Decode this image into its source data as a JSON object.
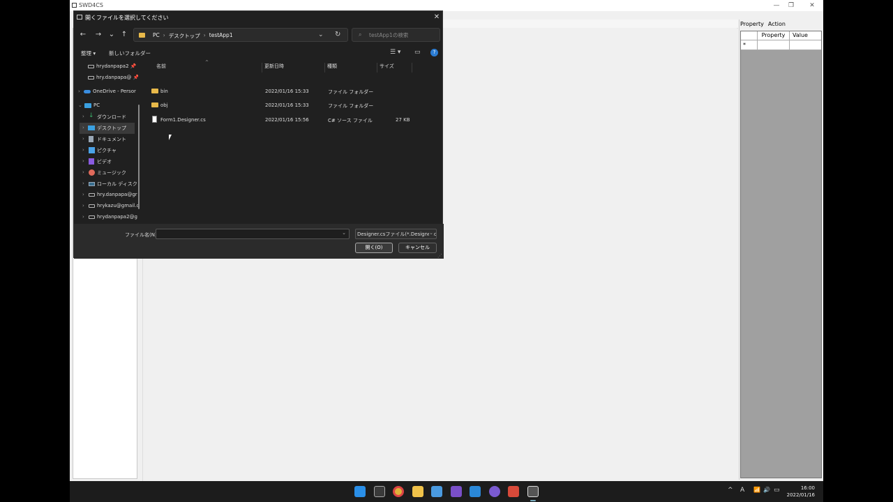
{
  "app": {
    "title": "SWD4CS",
    "window_controls": {
      "minimize": "—",
      "restore": "❐",
      "close": "✕"
    },
    "property_panel": {
      "tabs": [
        "Property",
        "Action"
      ],
      "columns": [
        "Property",
        "Value"
      ],
      "new_row_marker": "*"
    }
  },
  "dialog": {
    "title": "開くファイルを選択してください",
    "close": "✕",
    "nav": {
      "back": "←",
      "forward": "→",
      "recent": "⌄",
      "up": "↑",
      "dropdown": "⌄",
      "refresh": "↻"
    },
    "breadcrumb": [
      "PC",
      "デスクトップ",
      "testApp1"
    ],
    "breadcrumb_sep": "›",
    "search_placeholder": "testApp1の検索",
    "commands": {
      "organize": "整理 ▾",
      "new_folder": "新しいフォルダー",
      "view": "☰ ▾",
      "preview": "▭",
      "help": "?"
    },
    "nav_pane": [
      {
        "label": "hrydanpapa2 📌",
        "icon": "drive-icon"
      },
      {
        "label": "hry.danpapa@ 📌",
        "icon": "drive-icon"
      },
      {
        "label": "OneDrive - Persor",
        "icon": "onedrive-icon"
      },
      {
        "label": "PC",
        "icon": "pc-icon"
      },
      {
        "label": "ダウンロード",
        "icon": "download-icon"
      },
      {
        "label": "デスクトップ",
        "icon": "desktop-icon"
      },
      {
        "label": "ドキュメント",
        "icon": "document-icon"
      },
      {
        "label": "ピクチャ",
        "icon": "picture-icon"
      },
      {
        "label": "ビデオ",
        "icon": "video-icon"
      },
      {
        "label": "ミュージック",
        "icon": "music-icon"
      },
      {
        "label": "ローカル ディスク (C",
        "icon": "disk-icon"
      },
      {
        "label": "hry.danpapa@gr",
        "icon": "drive-icon"
      },
      {
        "label": "hrykazu@gmail.c",
        "icon": "drive-icon"
      },
      {
        "label": "hrydanpapa2@g",
        "icon": "drive-icon"
      }
    ],
    "columns": {
      "name": "名前",
      "modified": "更新日時",
      "type": "種類",
      "size": "サイズ"
    },
    "files": [
      {
        "name": "bin",
        "modified": "2022/01/16 15:33",
        "type": "ファイル フォルダー",
        "size": "",
        "icon": "folder-icon"
      },
      {
        "name": "obj",
        "modified": "2022/01/16 15:33",
        "type": "ファイル フォルダー",
        "size": "",
        "icon": "folder-icon"
      },
      {
        "name": "Form1.Designer.cs",
        "modified": "2022/01/16 15:56",
        "type": "C# ソース ファイル",
        "size": "27 KB",
        "icon": "csharp-file-icon"
      }
    ],
    "filename_label": "ファイル名(N):",
    "filename_value": "",
    "filetype_value": "Designer.csファイル(*.Designer.cs)",
    "open_button": "開く(O)",
    "cancel_button": "キャンセル"
  },
  "taskbar": {
    "icons": [
      "windows-start-icon",
      "task-view-icon",
      "chrome-icon",
      "file-explorer-icon",
      "store-icon",
      "visual-studio-icon",
      "vscode-icon",
      "github-icon",
      "office-icon",
      "swd4cs-app-icon"
    ],
    "tray": {
      "chevron": "^",
      "ime": "A",
      "wifi": "📶",
      "volume": "🔊",
      "battery": "▭"
    },
    "time": "16:00",
    "date": "2022/01/16"
  },
  "colors": {
    "accent": "#2b7cd3",
    "folder": "#e8b94a",
    "dialog_bg": "#202020"
  }
}
